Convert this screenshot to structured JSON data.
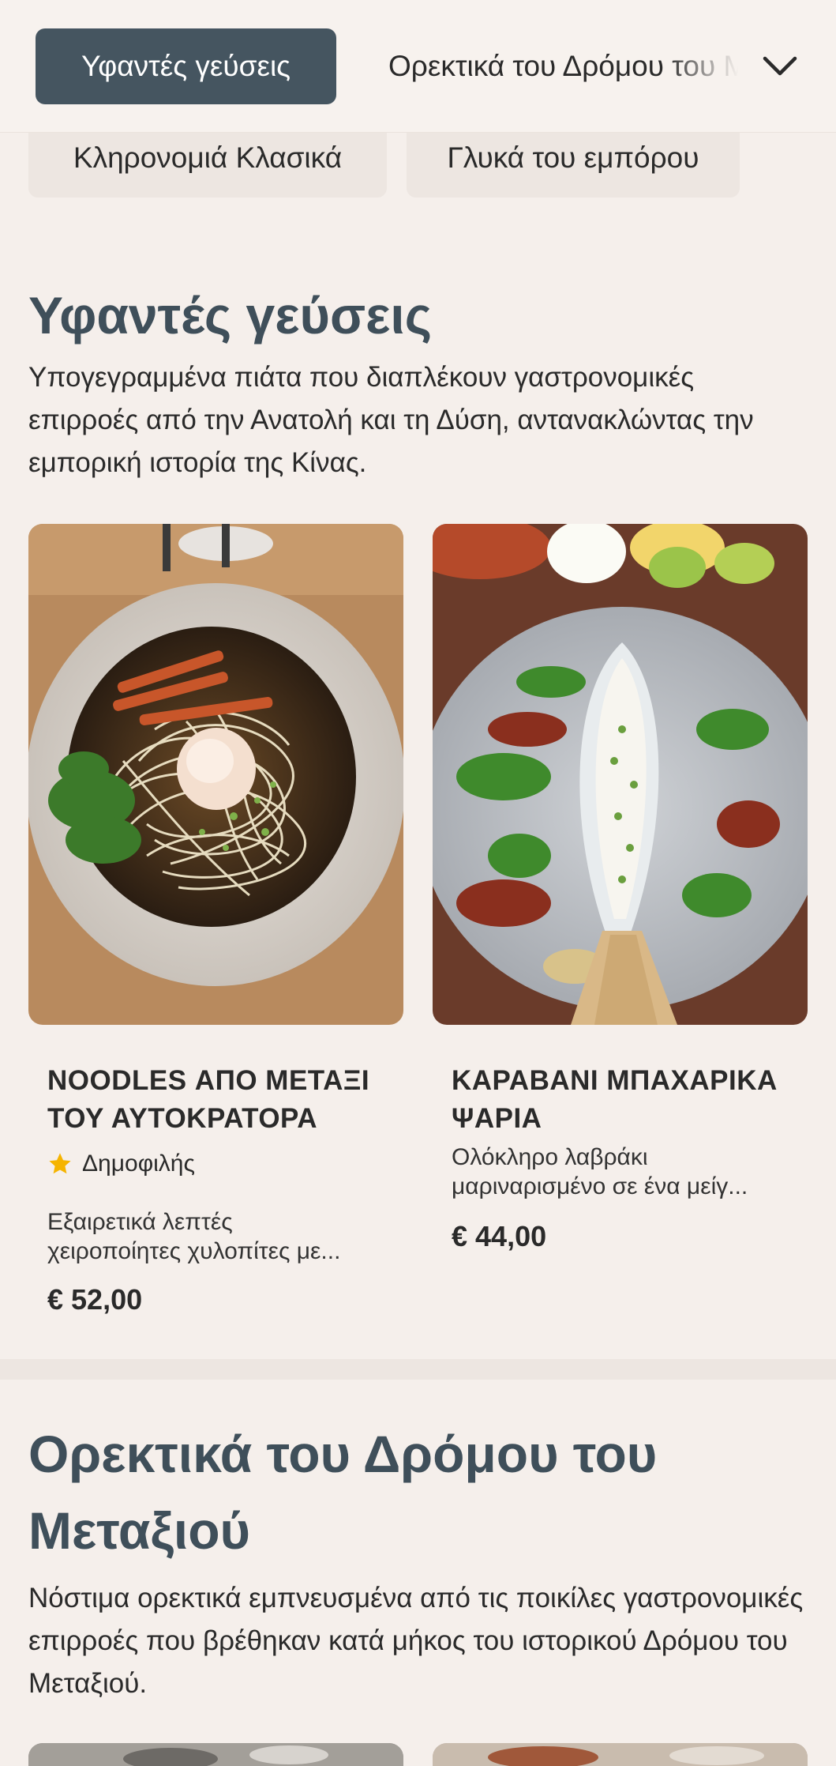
{
  "nav": {
    "active_tab": "Υφαντές γεύσεις",
    "next_tab": "Ορεκτικά του Δρόμου του Μεταξιού",
    "chips": [
      "Κληρονομιά Κλασικά",
      "Γλυκά του εμπόρου"
    ]
  },
  "section1": {
    "title": "Υφαντές γεύσεις",
    "description": "Υπογεγραμμένα πιάτα που διαπλέκουν γαστρονομικές επιρροές από την Ανατολή και τη Δύση, αντανακλώντας την εμπορική ιστορία της Κίνας.",
    "items": [
      {
        "title_line1": "NOODLES ΑΠΟ ΜΕΤΑΞΙ",
        "title_line2": "ΤΟΥ ΑΥΤΟΚΡΑΤΟΡΑ",
        "badge": "Δημοφιλής",
        "desc_line1": "Εξαιρετικά λεπτές",
        "desc_line2": "χειροποίητες χυλοπίτες με...",
        "price": "€ 52,00"
      },
      {
        "title_line1": "ΚΑΡΑΒΑΝΙ ΜΠΑΧΑΡΙΚΑ",
        "title_line2": "ΨΑΡΙΑ",
        "desc_line1": "Ολόκληρο λαβράκι",
        "desc_line2": "μαριναρισμένο σε ένα μείγ...",
        "price": "€ 44,00"
      }
    ]
  },
  "section2": {
    "title": "Ορεκτικά του Δρόμου του Μεταξιού",
    "description": "Νόστιμα ορεκτικά εμπνευσμένα από τις ποικίλες γαστρονομικές επιρροές που βρέθηκαν κατά μήκος του ιστορικού Δρόμου του Μεταξιού."
  },
  "colors": {
    "accent": "#455560",
    "background": "#f5efeb",
    "star": "#f5b400"
  }
}
